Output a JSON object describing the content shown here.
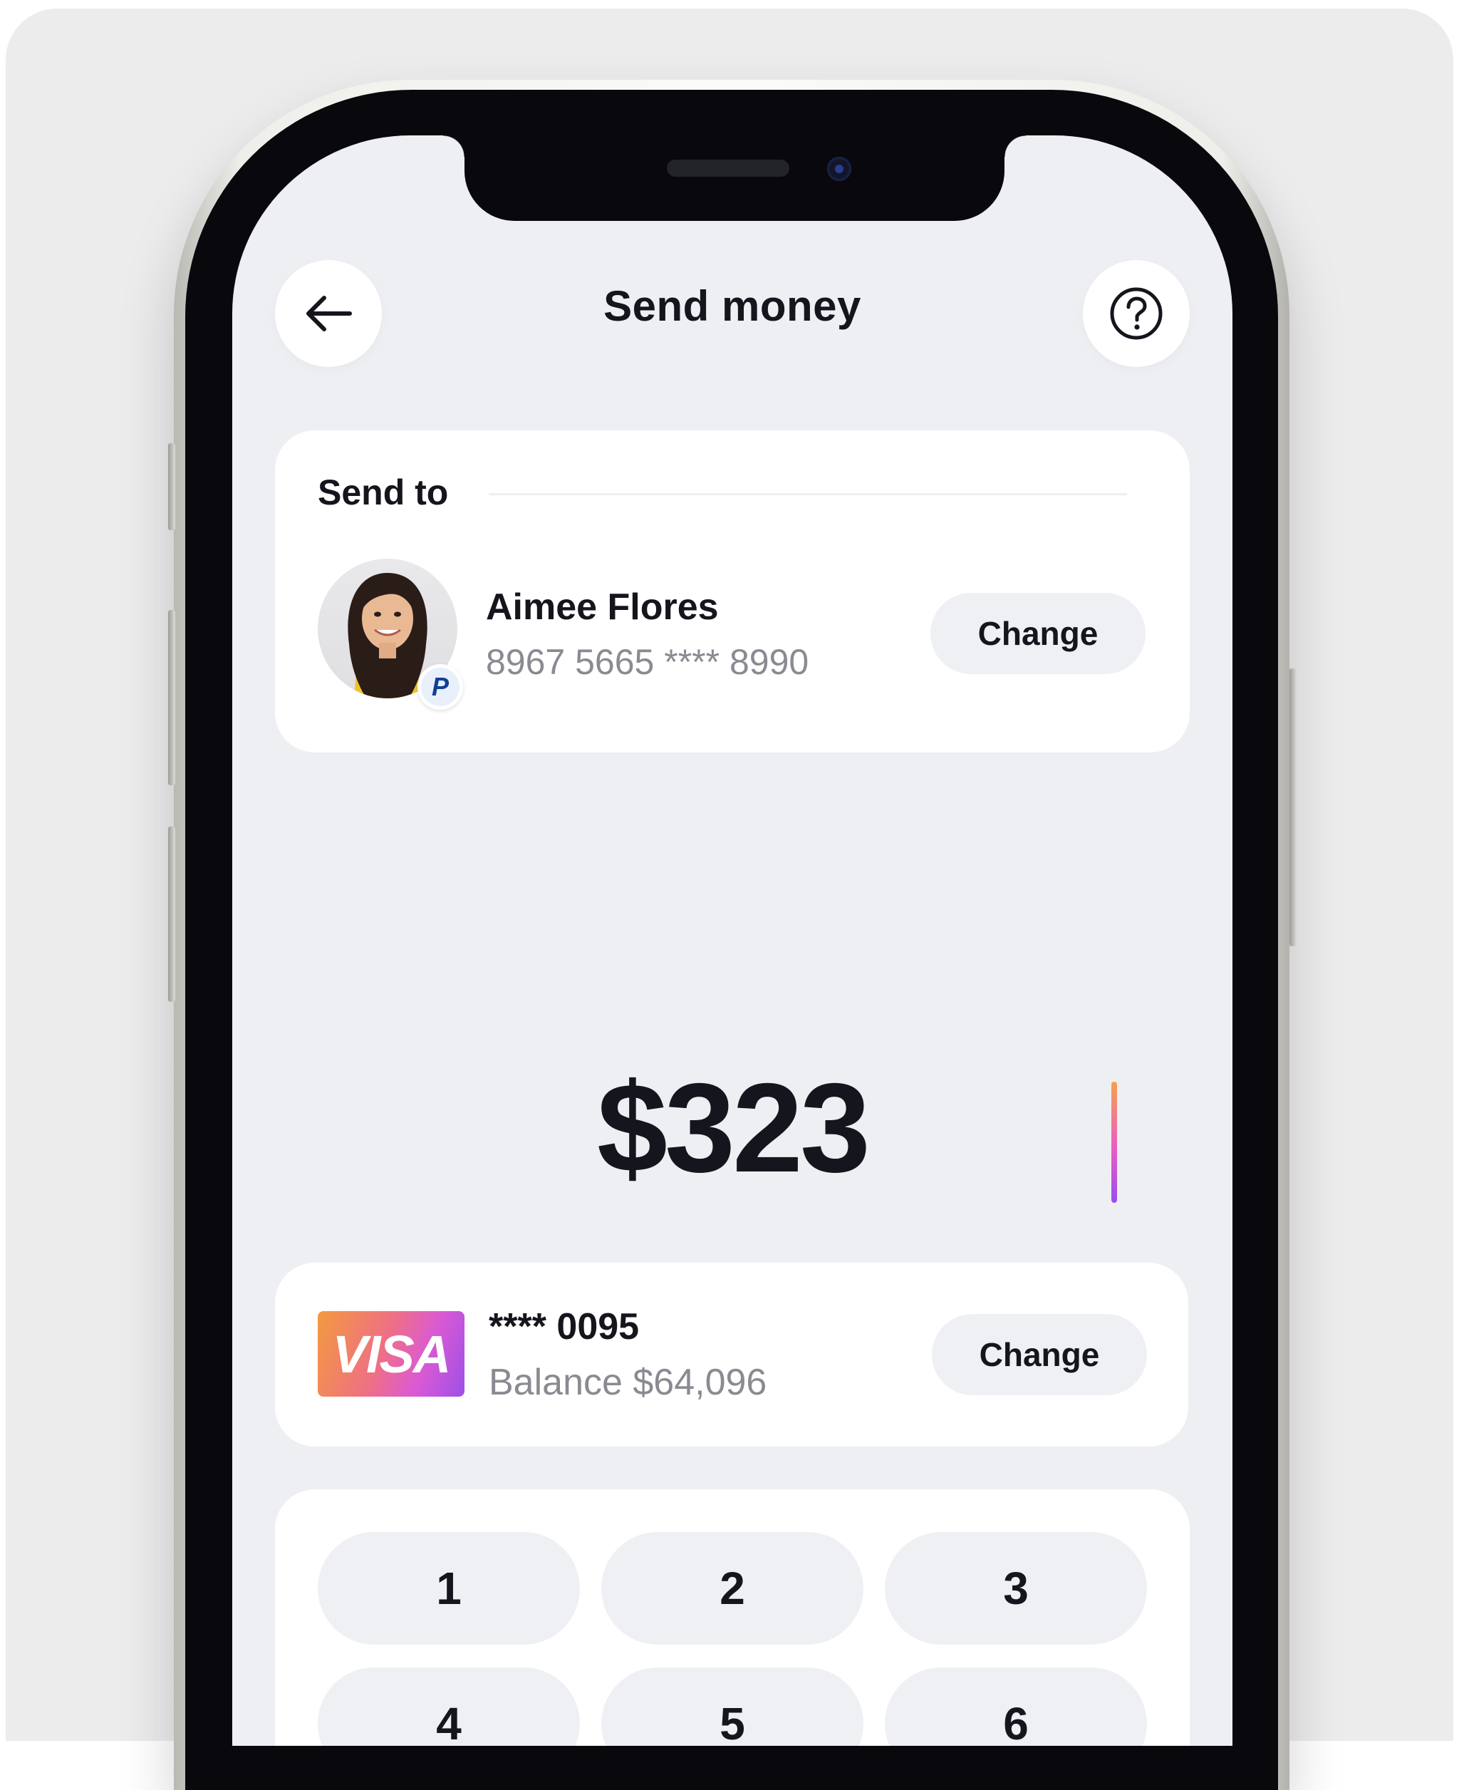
{
  "header": {
    "title": "Send money",
    "back_icon": "arrow-left-icon",
    "help_icon": "help-circle-icon"
  },
  "recipient": {
    "section_label": "Send to",
    "name": "Aimee Flores",
    "account_number": "8967 5665 **** 8990",
    "change_label": "Change",
    "badge_icon": "paypal-icon",
    "badge_text": "P"
  },
  "amount": {
    "value": "$323"
  },
  "source_card": {
    "brand": "VISA",
    "masked_number": "**** 0095",
    "balance": "Balance $64,096",
    "change_label": "Change"
  },
  "keypad": {
    "keys": [
      "1",
      "2",
      "3",
      "4",
      "5",
      "6"
    ]
  },
  "colors": {
    "screen_bg": "#eeeff3",
    "card_bg": "#ffffff",
    "text_primary": "#15151d",
    "text_secondary": "#8a8a92",
    "accent_gradient_start": "#f39a3e",
    "accent_gradient_end": "#9e4fe8"
  }
}
